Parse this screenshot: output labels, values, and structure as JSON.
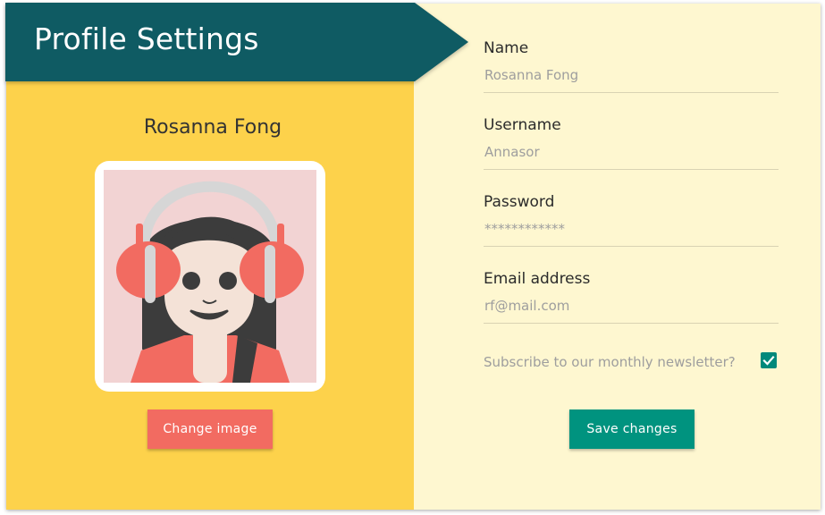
{
  "header": {
    "title": "Profile Settings",
    "ribbon_color": "#0f5b63"
  },
  "profile": {
    "display_name": "Rosanna Fong",
    "avatar_icon": "avatar-girl-headphones-icon",
    "change_image_label": "Change image"
  },
  "form": {
    "name": {
      "label": "Name",
      "value": "Rosanna Fong"
    },
    "username": {
      "label": "Username",
      "value": "Annasor"
    },
    "password": {
      "label": "Password",
      "value": "************"
    },
    "email": {
      "label": "Email address",
      "value": "rf@mail.com"
    },
    "newsletter": {
      "label": "Subscribe to our monthly newsletter?",
      "checked": true,
      "check_icon": "checkmark-icon"
    },
    "save_label": "Save changes"
  },
  "colors": {
    "left_panel": "#fdd24b",
    "right_panel": "#fef7d0",
    "change_button": "#f26b61",
    "save_button": "#00937f",
    "checkbox": "#00897b"
  }
}
